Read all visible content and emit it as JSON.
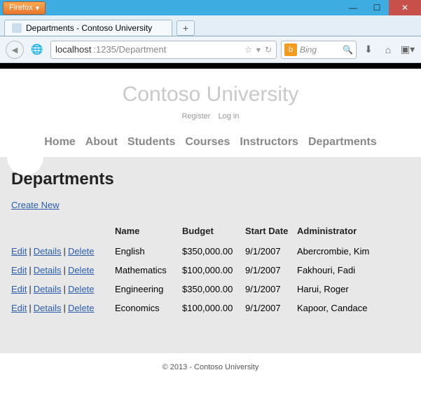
{
  "browser": {
    "firefox_label": "Firefox",
    "tab_title": "Departments - Contoso University",
    "url_host": "localhost",
    "url_port_path": ":1235/Department",
    "search_placeholder": "Bing"
  },
  "site": {
    "title": "Contoso University",
    "register": "Register",
    "login": "Log in",
    "nav": {
      "home": "Home",
      "about": "About",
      "students": "Students",
      "courses": "Courses",
      "instructors": "Instructors",
      "departments": "Departments"
    }
  },
  "page": {
    "heading": "Departments",
    "create_new": "Create New",
    "columns": {
      "name": "Name",
      "budget": "Budget",
      "start_date": "Start Date",
      "administrator": "Administrator"
    },
    "actions": {
      "edit": "Edit",
      "details": "Details",
      "delete": "Delete"
    },
    "rows": [
      {
        "name": "English",
        "budget": "$350,000.00",
        "start_date": "9/1/2007",
        "administrator": "Abercrombie, Kim"
      },
      {
        "name": "Mathematics",
        "budget": "$100,000.00",
        "start_date": "9/1/2007",
        "administrator": "Fakhouri, Fadi"
      },
      {
        "name": "Engineering",
        "budget": "$350,000.00",
        "start_date": "9/1/2007",
        "administrator": "Harui, Roger"
      },
      {
        "name": "Economics",
        "budget": "$100,000.00",
        "start_date": "9/1/2007",
        "administrator": "Kapoor, Candace"
      }
    ]
  },
  "footer": "© 2013 - Contoso University"
}
